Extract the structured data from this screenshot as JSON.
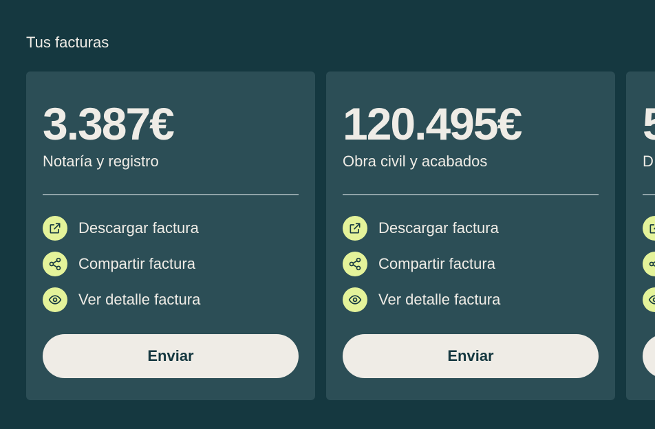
{
  "section": {
    "title": "Tus facturas"
  },
  "cards": [
    {
      "amount": "3.387€",
      "concept": "Notaría y registro",
      "actions": [
        {
          "label": "Descargar factura",
          "icon": "external-link-icon"
        },
        {
          "label": "Compartir factura",
          "icon": "share-icon"
        },
        {
          "label": "Ver detalle factura",
          "icon": "eye-icon"
        }
      ],
      "button_label": "Enviar"
    },
    {
      "amount": "120.495€",
      "concept": "Obra civil y acabados",
      "actions": [
        {
          "label": "Descargar factura",
          "icon": "external-link-icon"
        },
        {
          "label": "Compartir factura",
          "icon": "share-icon"
        },
        {
          "label": "Ver detalle factura",
          "icon": "eye-icon"
        }
      ],
      "button_label": "Enviar"
    },
    {
      "amount": "5",
      "concept": "D",
      "actions": [
        {
          "label": "",
          "icon": "external-link-icon"
        },
        {
          "label": "",
          "icon": "share-icon"
        },
        {
          "label": "",
          "icon": "eye-icon"
        }
      ],
      "button_label": ""
    }
  ],
  "colors": {
    "background": "#153840",
    "card": "#2C4E56",
    "accent": "#E4F39A",
    "text": "#EFECE6",
    "button": "#EFECE6",
    "button_text": "#153840",
    "divider": "#8FA3A7"
  }
}
